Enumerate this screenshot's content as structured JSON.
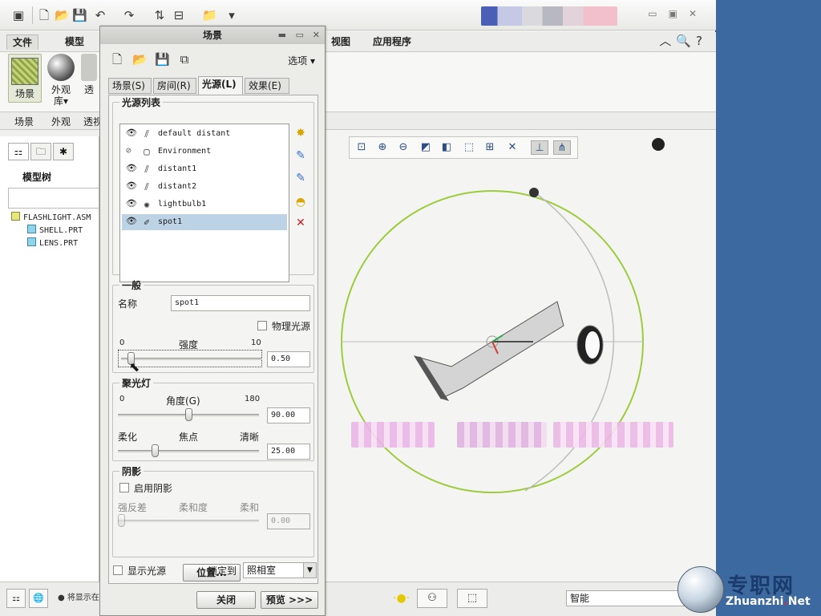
{
  "app": {
    "menu": [
      "文件",
      "模型",
      "视图",
      "应用程序"
    ],
    "ribbon": {
      "scene_label": "场景",
      "appearance_label": "外观\n库",
      "transparency_label": "透"
    },
    "groups": [
      "场景",
      "外观",
      "透视"
    ],
    "tree_title": "模型树",
    "tree_items": [
      "FLASHLIGHT.ASM",
      "SHELL.PRT",
      "LENS.PRT"
    ],
    "status_message": "将显示在",
    "filter_value": "智能"
  },
  "dialog": {
    "title": "场景",
    "options_label": "选项",
    "tabs": [
      "场景(S)",
      "房间(R)",
      "光源(L)",
      "效果(E)"
    ],
    "active_tab": "光源(L)",
    "light_list_title": "光源列表",
    "lights": [
      {
        "name": "default distant",
        "visible": true,
        "type": "distant"
      },
      {
        "name": "Environment",
        "visible": false,
        "type": "environment"
      },
      {
        "name": "distant1",
        "visible": true,
        "type": "distant"
      },
      {
        "name": "distant2",
        "visible": true,
        "type": "distant"
      },
      {
        "name": "lightbulb1",
        "visible": true,
        "type": "bulb"
      },
      {
        "name": "spot1",
        "visible": true,
        "type": "spot",
        "selected": true
      }
    ],
    "general": {
      "title": "一般",
      "name_label": "名称",
      "name_value": "spot1",
      "physical_label": "物理光源",
      "intensity_label": "强度",
      "intensity_min": "0",
      "intensity_max": "10",
      "intensity_value": "0.50",
      "intensity_fraction": 0.05
    },
    "spotlight": {
      "title": "聚光灯",
      "angle_label": "角度(G)",
      "angle_min": "0",
      "angle_max": "180",
      "angle_value": "90.00",
      "angle_fraction": 0.5,
      "soft_label": "柔化",
      "focus_label": "焦点",
      "sharp_label": "清晰",
      "focus_value": "25.00",
      "focus_fraction": 0.25
    },
    "shadow": {
      "title": "阴影",
      "enable_label": "启用阴影",
      "strong_label": "强反差",
      "softness_label": "柔和度",
      "soft_label": "柔和",
      "value": "0.00"
    },
    "position_button": "位置...",
    "show_lights_label": "显示光源",
    "lock_label": "锁定到",
    "lock_value": "照相室",
    "close_button": "关闭",
    "preview_button": "预览 >>>"
  },
  "watermark": {
    "cn": "专职网",
    "en_main": "Zhuanzhi",
    "en_dot": ".",
    "en_tail": "Net"
  },
  "colors": {
    "selection": "#bcd3e6",
    "sphere_ring": "#9ccc3c",
    "desktop": "#3c6aa0"
  }
}
